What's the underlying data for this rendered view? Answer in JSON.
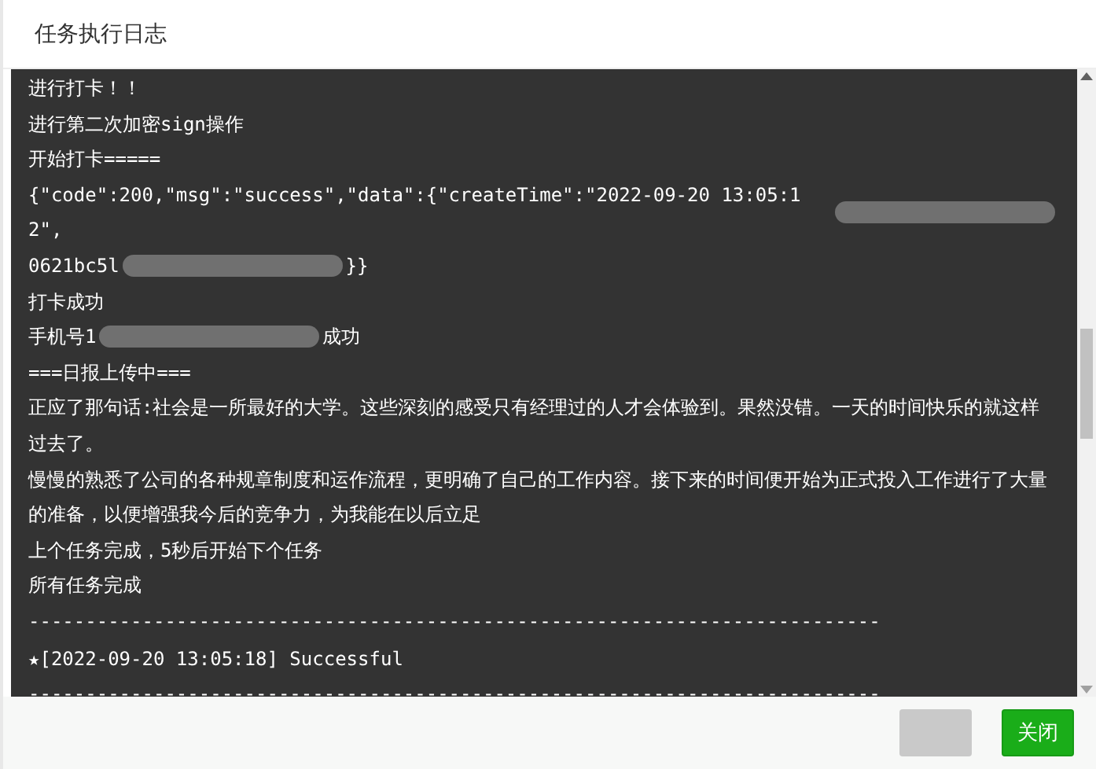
{
  "window": {
    "title": "任务执行日志"
  },
  "log_lines": [
    {
      "kind": "text",
      "segments": [
        {
          "kind": "text",
          "text": "进行打卡！！"
        }
      ]
    },
    {
      "kind": "text",
      "segments": [
        {
          "kind": "text",
          "text": "进行第二次加密sign操作"
        }
      ]
    },
    {
      "kind": "text",
      "segments": [
        {
          "kind": "text",
          "text": "开始打卡====="
        }
      ]
    },
    {
      "kind": "text",
      "segments": [
        {
          "kind": "text",
          "text": "{\"code\":200,\"msg\":\"success\",\"data\":{\"createTime\":\"2022-09-20 13:05:12\","
        },
        {
          "kind": "blur"
        }
      ]
    },
    {
      "kind": "text",
      "segments": [
        {
          "kind": "text",
          "text": "0621bc5l"
        },
        {
          "kind": "blur"
        },
        {
          "kind": "text",
          "text": "}}"
        }
      ]
    },
    {
      "kind": "text",
      "segments": [
        {
          "kind": "text",
          "text": "打卡成功"
        }
      ]
    },
    {
      "kind": "text",
      "segments": [
        {
          "kind": "text",
          "text": "手机号1"
        },
        {
          "kind": "blur"
        },
        {
          "kind": "text",
          "text": "成功"
        }
      ]
    },
    {
      "kind": "text",
      "segments": [
        {
          "kind": "text",
          "text": "===日报上传中==="
        }
      ]
    },
    {
      "kind": "text",
      "segments": [
        {
          "kind": "text",
          "text": "正应了那句话:社会是一所最好的大学。这些深刻的感受只有经理过的人才会体验到。果然没错。一天的时间快乐的就这样过去了。"
        }
      ]
    },
    {
      "kind": "text",
      "segments": [
        {
          "kind": "text",
          "text": "慢慢的熟悉了公司的各种规章制度和运作流程，更明确了自己的工作内容。接下来的时间便开始为正式投入工作进行了大量的准备，以便增强我今后的竞争力，为我能在以后立足"
        }
      ]
    },
    {
      "kind": "text",
      "segments": [
        {
          "kind": "text",
          "text": "上个任务完成，5秒后开始下个任务"
        }
      ]
    },
    {
      "kind": "text",
      "segments": [
        {
          "kind": "text",
          "text": "所有任务完成"
        }
      ]
    },
    {
      "kind": "rule",
      "segments": [
        {
          "kind": "text",
          "text": "---------------------------------------------------------------------------"
        }
      ]
    },
    {
      "kind": "result",
      "segments": [
        {
          "kind": "text",
          "text": "★[2022-09-20 13:05:18] Successful"
        }
      ]
    },
    {
      "kind": "rule",
      "segments": [
        {
          "kind": "text",
          "text": "---------------------------------------------------------------------------"
        }
      ]
    }
  ],
  "buttons": [
    {
      "kind": "plain"
    },
    {
      "kind": "primary",
      "label": "关闭"
    }
  ]
}
